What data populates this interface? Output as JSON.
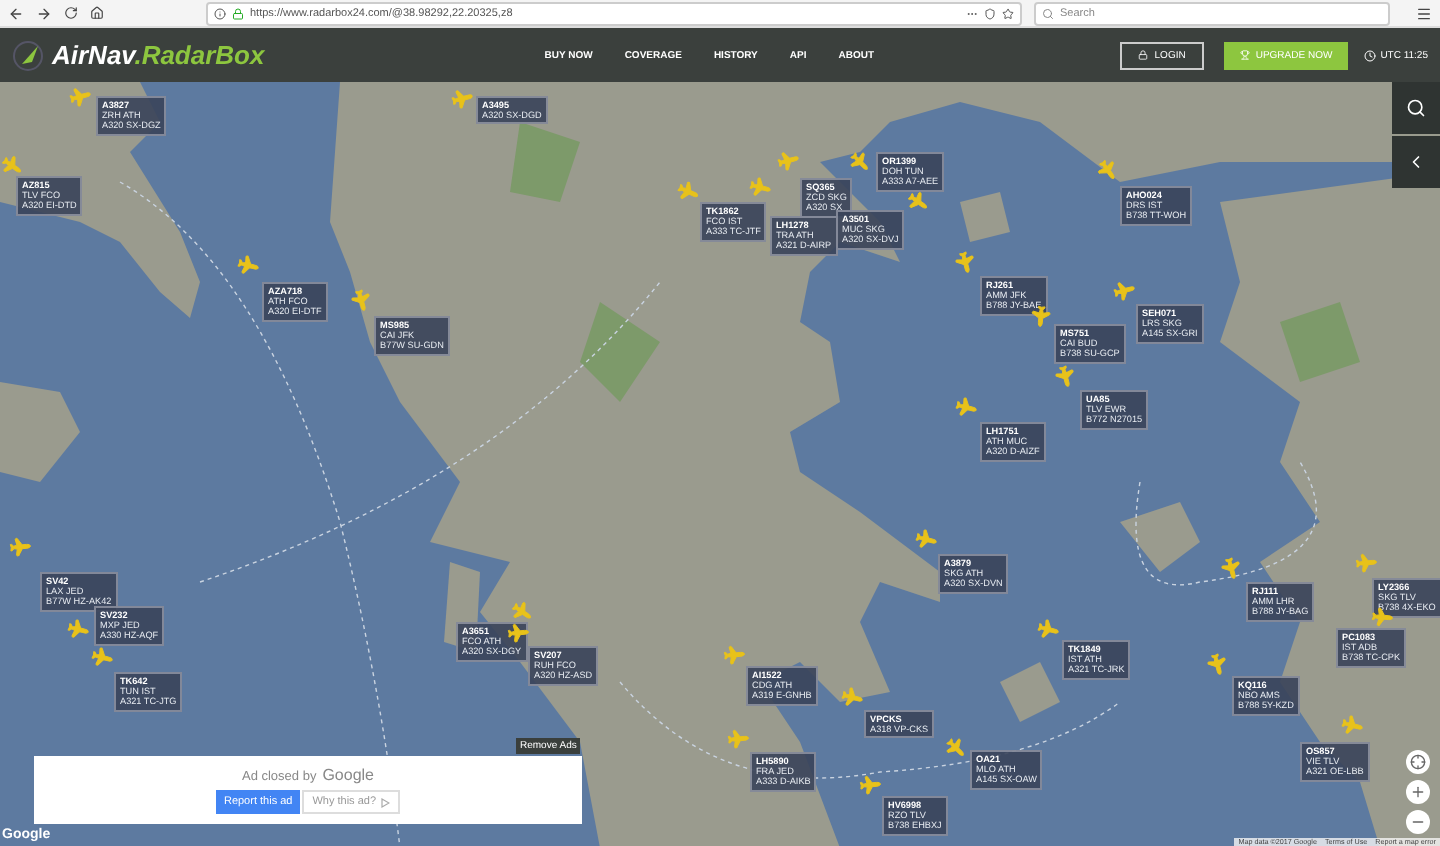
{
  "browser": {
    "url": "https://www.radarbox24.com/@38.98292,22.20325,z8",
    "search_placeholder": "Search"
  },
  "header": {
    "brand_main": "AirNav",
    "brand_accent": ".RadarBox",
    "nav": [
      "BUY NOW",
      "COVERAGE",
      "HISTORY",
      "API",
      "ABOUT"
    ],
    "login": "LOGIN",
    "upgrade": "UPGRADE NOW",
    "clock": "UTC 11:25"
  },
  "flights": [
    {
      "callsign": "A3827",
      "route": "ZRH ATH",
      "aircraft": "A320 SX-DGZ"
    },
    {
      "callsign": "A3495",
      "aircraft": "A320 SX-DGD"
    },
    {
      "callsign": "AZ815",
      "route": "TLV FCO",
      "aircraft": "A320 EI-DTD"
    },
    {
      "callsign": "AZA718",
      "route": "ATH FCO",
      "aircraft": "A320 EI-DTF"
    },
    {
      "callsign": "MS985",
      "route": "CAI JFK",
      "aircraft": "B77W SU-GDN"
    },
    {
      "callsign": "TK1862",
      "route": "FCO IST",
      "aircraft": "A333 TC-JTF"
    },
    {
      "callsign": "OR1399",
      "route": "DOH TUN",
      "aircraft": "A333 A7-AEE"
    },
    {
      "callsign": "SQ365",
      "route": "ZCD SKG",
      "aircraft": "A320 SX"
    },
    {
      "callsign": "LH1278",
      "route": "TRA ATH",
      "aircraft": "A321 D-AIRP"
    },
    {
      "callsign": "A3501",
      "route": "MUC SKG",
      "aircraft": "A320 SX-DVJ"
    },
    {
      "callsign": "AHO024",
      "route": "DRS IST",
      "aircraft": "B738 TT-WOH"
    },
    {
      "callsign": "RJ261",
      "route": "AMM JFK",
      "aircraft": "B788 JY-BAE"
    },
    {
      "callsign": "SEH071",
      "route": "LRS SKG",
      "aircraft": "A145 SX-GRI"
    },
    {
      "callsign": "MS751",
      "route": "CAI BUD",
      "aircraft": "B738 SU-GCP"
    },
    {
      "callsign": "UA85",
      "route": "TLV EWR",
      "aircraft": "B772 N27015"
    },
    {
      "callsign": "LH1751",
      "route": "ATH MUC",
      "aircraft": "A320 D-AIZF"
    },
    {
      "callsign": "SV42",
      "route": "LAX JED",
      "aircraft": "B77W HZ-AK42"
    },
    {
      "callsign": "SV232",
      "route": "MXP JED",
      "aircraft": "A330 HZ-AQF"
    },
    {
      "callsign": "TK642",
      "route": "TUN IST",
      "aircraft": "A321 TC-JTG"
    },
    {
      "callsign": "A3651",
      "route": "FCO ATH",
      "aircraft": "A320 SX-DGY"
    },
    {
      "callsign": "SV207",
      "route": "RUH FCO",
      "aircraft": "A320 HZ-ASD"
    },
    {
      "callsign": "A3879",
      "route": "SKG ATH",
      "aircraft": "A320 SX-DVN"
    },
    {
      "callsign": "AI1522",
      "route": "CDG ATH",
      "aircraft": "A319 E-GNHB"
    },
    {
      "callsign": "TK1849",
      "route": "IST ATH",
      "aircraft": "A321 TC-JRK"
    },
    {
      "callsign": "RJ111",
      "route": "AMM LHR",
      "aircraft": "B788 JY-BAG"
    },
    {
      "callsign": "LY2366",
      "route": "SKG TLV",
      "aircraft": "B738 4X-EKO"
    },
    {
      "callsign": "PC1083",
      "route": "IST ADB",
      "aircraft": "B738 TC-CPK"
    },
    {
      "callsign": "KQ116",
      "route": "NBO AMS",
      "aircraft": "B788 5Y-KZD"
    },
    {
      "callsign": "VPCKS",
      "aircraft": "A318 VP-CKS"
    },
    {
      "callsign": "LH5890",
      "route": "FRA JED",
      "aircraft": "A333 D-AIKB"
    },
    {
      "callsign": "OA21",
      "route": "MLO ATH",
      "aircraft": "A145 SX-OAW"
    },
    {
      "callsign": "HV6998",
      "route": "RZO TLV",
      "aircraft": "B738 EHBXJ"
    },
    {
      "callsign": "OS857",
      "route": "VIE TLV",
      "aircraft": "A321 OE-LBB"
    }
  ],
  "ad": {
    "closed_text": "Ad closed by",
    "brand": "Google",
    "report": "Report this ad",
    "why": "Why this ad?",
    "remove": "Remove Ads"
  },
  "map": {
    "logo": "Google",
    "attribution": [
      "Map data ©2017 Google",
      "Terms of Use",
      "Report a map error"
    ]
  }
}
